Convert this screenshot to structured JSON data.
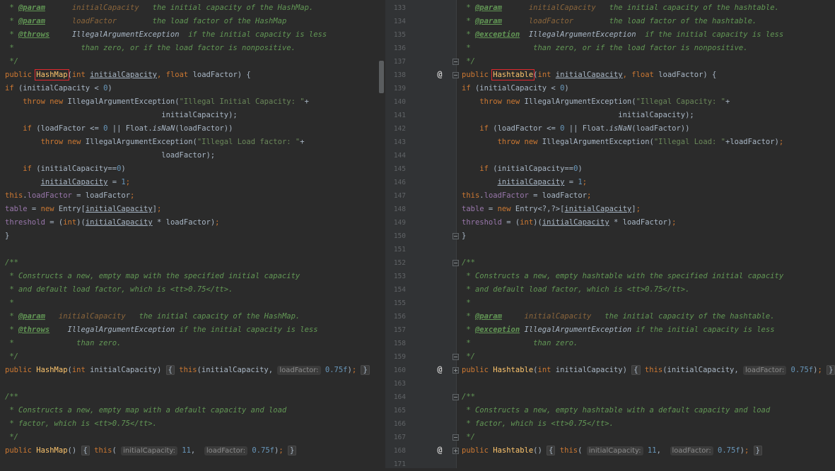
{
  "left_pane": {
    "lines": [
      [
        [
          "cm",
          " * "
        ],
        [
          "tg",
          "@param"
        ],
        [
          "cm",
          "      "
        ],
        [
          "pm",
          "initialCapacity"
        ],
        [
          "cm",
          "   the initial capacity of the HashMap."
        ]
      ],
      [
        [
          "cm",
          " * "
        ],
        [
          "tg",
          "@param"
        ],
        [
          "cm",
          "      "
        ],
        [
          "pm",
          "loadFactor"
        ],
        [
          "cm",
          "        the load factor of the HashMap"
        ]
      ],
      [
        [
          "cm",
          " * "
        ],
        [
          "tg",
          "@throws"
        ],
        [
          "cm",
          "     "
        ],
        [
          "it",
          "IllegalArgumentException"
        ],
        [
          "cm",
          "  if the initial capacity is less"
        ]
      ],
      [
        [
          "cm",
          " *               than zero, or if the load factor is nonpositive."
        ]
      ],
      [
        [
          "cm",
          " */"
        ]
      ],
      [
        [
          "kw",
          "public "
        ],
        [
          "bx",
          "HashMap"
        ],
        [
          "tx",
          "("
        ],
        [
          "kw",
          "int "
        ],
        [
          "ul",
          "initialCapacity"
        ],
        [
          "kw",
          ", float "
        ],
        [
          "tx",
          "loadFactor) {"
        ]
      ],
      [
        [
          "kw",
          "if "
        ],
        [
          "tx",
          "(initialCapacity < "
        ],
        [
          "nm",
          "0"
        ],
        [
          "tx",
          ")"
        ]
      ],
      [
        [
          "tx",
          "    "
        ],
        [
          "kw",
          "throw new "
        ],
        [
          "tx",
          "IllegalArgumentException("
        ],
        [
          "st",
          "\"Illegal Initial Capacity: \""
        ],
        [
          "tx",
          "+"
        ]
      ],
      [
        [
          "tx",
          "                                   initialCapacity);"
        ]
      ],
      [
        [
          "tx",
          "    "
        ],
        [
          "kw",
          "if "
        ],
        [
          "tx",
          "(loadFactor <= "
        ],
        [
          "nm",
          "0 "
        ],
        [
          "tx",
          "|| Float."
        ],
        [
          "it",
          "isNaN"
        ],
        [
          "tx",
          "(loadFactor))"
        ]
      ],
      [
        [
          "tx",
          "        "
        ],
        [
          "kw",
          "throw new "
        ],
        [
          "tx",
          "IllegalArgumentException("
        ],
        [
          "st",
          "\"Illegal Load factor: \""
        ],
        [
          "tx",
          "+"
        ]
      ],
      [
        [
          "tx",
          "                                   loadFactor);"
        ]
      ],
      [
        [
          "tx",
          "    "
        ],
        [
          "kw",
          "if "
        ],
        [
          "tx",
          "(initialCapacity=="
        ],
        [
          "nm",
          "0"
        ],
        [
          "tx",
          ")"
        ]
      ],
      [
        [
          "tx",
          "        "
        ],
        [
          "ul",
          "initialCapacity"
        ],
        [
          "tx",
          " = "
        ],
        [
          "nm",
          "1"
        ],
        [
          "kw",
          ";"
        ]
      ],
      [
        [
          "kw",
          "this"
        ],
        [
          "tx",
          "."
        ],
        [
          "fd",
          "loadFactor"
        ],
        [
          "tx",
          " = loadFactor"
        ],
        [
          "kw",
          ";"
        ]
      ],
      [
        [
          "fd",
          "table"
        ],
        [
          "tx",
          " = "
        ],
        [
          "kw",
          "new "
        ],
        [
          "tx",
          "Entry["
        ],
        [
          "ul",
          "initialCapacity"
        ],
        [
          "tx",
          "]"
        ],
        [
          "kw",
          ";"
        ]
      ],
      [
        [
          "fd",
          "threshold"
        ],
        [
          "tx",
          " = ("
        ],
        [
          "kw",
          "int"
        ],
        [
          "tx",
          ")("
        ],
        [
          "ul",
          "initialCapacity"
        ],
        [
          "tx",
          " * loadFactor)"
        ],
        [
          "kw",
          ";"
        ]
      ],
      [
        [
          "tx",
          "}"
        ]
      ],
      [],
      [
        [
          "cm",
          "/**"
        ]
      ],
      [
        [
          "cm",
          " * Constructs a new, empty map with the specified initial capacity"
        ]
      ],
      [
        [
          "cm",
          " * and default load factor, which is <tt>0.75</tt>."
        ]
      ],
      [
        [
          "cm",
          " *"
        ]
      ],
      [
        [
          "cm",
          " * "
        ],
        [
          "tg",
          "@param"
        ],
        [
          "cm",
          "   "
        ],
        [
          "pm",
          "initialCapacity"
        ],
        [
          "cm",
          "   the initial capacity of the HashMap."
        ]
      ],
      [
        [
          "cm",
          " * "
        ],
        [
          "tg",
          "@throws"
        ],
        [
          "cm",
          "    "
        ],
        [
          "it",
          "IllegalArgumentException"
        ],
        [
          "cm",
          " if the initial capacity is less"
        ]
      ],
      [
        [
          "cm",
          " *              than zero."
        ]
      ],
      [
        [
          "cm",
          " */"
        ]
      ],
      [
        [
          "kw",
          "public "
        ],
        [
          "fn",
          "HashMap"
        ],
        [
          "tx",
          "("
        ],
        [
          "kw",
          "int "
        ],
        [
          "tx",
          "initialCapacity) "
        ],
        [
          "fb",
          "{"
        ],
        [
          "tx",
          " "
        ],
        [
          "kw",
          "this"
        ],
        [
          "tx",
          "(initialCapacity, "
        ],
        [
          "hn",
          "loadFactor:"
        ],
        [
          "nm",
          " 0.75f"
        ],
        [
          "tx",
          ")"
        ],
        [
          "kw",
          "; "
        ],
        [
          "fb",
          "}"
        ]
      ],
      [],
      [
        [
          "cm",
          "/**"
        ]
      ],
      [
        [
          "cm",
          " * Constructs a new, empty map with a default capacity and load"
        ]
      ],
      [
        [
          "cm",
          " * factor, which is <tt>0.75</tt>."
        ]
      ],
      [
        [
          "cm",
          " */"
        ]
      ],
      [
        [
          "kw",
          "public "
        ],
        [
          "fn",
          "HashMap"
        ],
        [
          "tx",
          "() "
        ],
        [
          "fb",
          "{"
        ],
        [
          "tx",
          " "
        ],
        [
          "kw",
          "this"
        ],
        [
          "tx",
          "( "
        ],
        [
          "hn",
          "initialCapacity:"
        ],
        [
          "nm",
          " 11"
        ],
        [
          "tx",
          ",  "
        ],
        [
          "hn",
          "loadFactor:"
        ],
        [
          "nm",
          " 0.75f"
        ],
        [
          "tx",
          ")"
        ],
        [
          "kw",
          "; "
        ],
        [
          "fb",
          "}"
        ]
      ]
    ]
  },
  "right_pane": {
    "lines": [
      [
        [
          "cm",
          " * "
        ],
        [
          "tg",
          "@param"
        ],
        [
          "cm",
          "      "
        ],
        [
          "pm",
          "initialCapacity"
        ],
        [
          "cm",
          "   the initial capacity of the hashtable."
        ]
      ],
      [
        [
          "cm",
          " * "
        ],
        [
          "tg",
          "@param"
        ],
        [
          "cm",
          "      "
        ],
        [
          "pm",
          "loadFactor"
        ],
        [
          "cm",
          "        the load factor of the hashtable."
        ]
      ],
      [
        [
          "cm",
          " * "
        ],
        [
          "tg",
          "@exception"
        ],
        [
          "cm",
          "  "
        ],
        [
          "it",
          "IllegalArgumentException"
        ],
        [
          "cm",
          "  if the initial capacity is less"
        ]
      ],
      [
        [
          "cm",
          " *              than zero, or if the load factor is nonpositive."
        ]
      ],
      [
        [
          "cm",
          " */"
        ]
      ],
      [
        [
          "kw",
          "public "
        ],
        [
          "bx",
          "Hashtable"
        ],
        [
          "tx",
          "("
        ],
        [
          "kw",
          "int "
        ],
        [
          "ul",
          "initialCapacity"
        ],
        [
          "kw",
          ", float "
        ],
        [
          "tx",
          "loadFactor) {"
        ]
      ],
      [
        [
          "kw",
          "if "
        ],
        [
          "tx",
          "(initialCapacity < "
        ],
        [
          "nm",
          "0"
        ],
        [
          "tx",
          ")"
        ]
      ],
      [
        [
          "tx",
          "    "
        ],
        [
          "kw",
          "throw new "
        ],
        [
          "tx",
          "IllegalArgumentException("
        ],
        [
          "st",
          "\"Illegal Capacity: \""
        ],
        [
          "tx",
          "+"
        ]
      ],
      [
        [
          "tx",
          "                                   initialCapacity);"
        ]
      ],
      [
        [
          "tx",
          "    "
        ],
        [
          "kw",
          "if "
        ],
        [
          "tx",
          "(loadFactor <= "
        ],
        [
          "nm",
          "0 "
        ],
        [
          "tx",
          "|| Float."
        ],
        [
          "it",
          "isNaN"
        ],
        [
          "tx",
          "(loadFactor))"
        ]
      ],
      [
        [
          "tx",
          "        "
        ],
        [
          "kw",
          "throw new "
        ],
        [
          "tx",
          "IllegalArgumentException("
        ],
        [
          "st",
          "\"Illegal Load: \""
        ],
        [
          "tx",
          "+loadFactor)"
        ],
        [
          "kw",
          ";"
        ]
      ],
      [],
      [
        [
          "tx",
          "    "
        ],
        [
          "kw",
          "if "
        ],
        [
          "tx",
          "(initialCapacity=="
        ],
        [
          "nm",
          "0"
        ],
        [
          "tx",
          ")"
        ]
      ],
      [
        [
          "tx",
          "        "
        ],
        [
          "ul",
          "initialCapacity"
        ],
        [
          "tx",
          " = "
        ],
        [
          "nm",
          "1"
        ],
        [
          "kw",
          ";"
        ]
      ],
      [
        [
          "kw",
          "this"
        ],
        [
          "tx",
          "."
        ],
        [
          "fd",
          "loadFactor"
        ],
        [
          "tx",
          " = loadFactor"
        ],
        [
          "kw",
          ";"
        ]
      ],
      [
        [
          "fd",
          "table"
        ],
        [
          "tx",
          " = "
        ],
        [
          "kw",
          "new "
        ],
        [
          "tx",
          "Entry<?,?>["
        ],
        [
          "ul",
          "initialCapacity"
        ],
        [
          "tx",
          "]"
        ],
        [
          "kw",
          ";"
        ]
      ],
      [
        [
          "fd",
          "threshold"
        ],
        [
          "tx",
          " = ("
        ],
        [
          "kw",
          "int"
        ],
        [
          "tx",
          ")("
        ],
        [
          "ul",
          "initialCapacity"
        ],
        [
          "tx",
          " * loadFactor)"
        ],
        [
          "kw",
          ";"
        ]
      ],
      [
        [
          "tx",
          "}"
        ]
      ],
      [],
      [
        [
          "cm",
          "/**"
        ]
      ],
      [
        [
          "cm",
          " * Constructs a new, empty hashtable with the specified initial capacity"
        ]
      ],
      [
        [
          "cm",
          " * and default load factor, which is <tt>0.75</tt>."
        ]
      ],
      [
        [
          "cm",
          " *"
        ]
      ],
      [
        [
          "cm",
          " * "
        ],
        [
          "tg",
          "@param"
        ],
        [
          "cm",
          "     "
        ],
        [
          "pm",
          "initialCapacity"
        ],
        [
          "cm",
          "   the initial capacity of the hashtable."
        ]
      ],
      [
        [
          "cm",
          " * "
        ],
        [
          "tg",
          "@exception"
        ],
        [
          "cm",
          " "
        ],
        [
          "it",
          "IllegalArgumentException"
        ],
        [
          "cm",
          " if the initial capacity is less"
        ]
      ],
      [
        [
          "cm",
          " *              than zero."
        ]
      ],
      [
        [
          "cm",
          " */"
        ]
      ],
      [
        [
          "kw",
          "public "
        ],
        [
          "fn",
          "Hashtable"
        ],
        [
          "tx",
          "("
        ],
        [
          "kw",
          "int "
        ],
        [
          "tx",
          "initialCapacity) "
        ],
        [
          "fb",
          "{"
        ],
        [
          "tx",
          " "
        ],
        [
          "kw",
          "this"
        ],
        [
          "tx",
          "(initialCapacity, "
        ],
        [
          "hn",
          "loadFactor:"
        ],
        [
          "nm",
          " 0.75f"
        ],
        [
          "tx",
          ")"
        ],
        [
          "kw",
          "; "
        ],
        [
          "fb",
          "}"
        ]
      ],
      [],
      [
        [
          "cm",
          "/**"
        ]
      ],
      [
        [
          "cm",
          " * Constructs a new, empty hashtable with a default capacity and load"
        ]
      ],
      [
        [
          "cm",
          " * factor, which is <tt>0.75</tt>."
        ]
      ],
      [
        [
          "cm",
          " */"
        ]
      ],
      [
        [
          "kw",
          "public "
        ],
        [
          "fn",
          "Hashtable"
        ],
        [
          "tx",
          "() "
        ],
        [
          "fb",
          "{"
        ],
        [
          "tx",
          " "
        ],
        [
          "kw",
          "this"
        ],
        [
          "tx",
          "( "
        ],
        [
          "hn",
          "initialCapacity:"
        ],
        [
          "nm",
          " 11"
        ],
        [
          "tx",
          ",  "
        ],
        [
          "hn",
          "loadFactor:"
        ],
        [
          "nm",
          " 0.75f"
        ],
        [
          "tx",
          ")"
        ],
        [
          "kw",
          "; "
        ],
        [
          "fb",
          "}"
        ]
      ]
    ]
  },
  "gutter": {
    "line_numbers": [
      "133",
      "134",
      "135",
      "136",
      "137",
      "138",
      "139",
      "140",
      "141",
      "142",
      "143",
      "144",
      "145",
      "146",
      "147",
      "148",
      "149",
      "150",
      "151",
      "152",
      "153",
      "154",
      "155",
      "156",
      "157",
      "158",
      "159",
      "160",
      "163",
      "164",
      "165",
      "166",
      "167",
      "168",
      "171"
    ],
    "override_marker": "@",
    "markers": [
      {
        "row": 5,
        "override": true,
        "fold": "minus"
      },
      {
        "row": 4,
        "fold": "minus"
      },
      {
        "row": 17,
        "fold": "minus"
      },
      {
        "row": 19,
        "fold": "minus"
      },
      {
        "row": 26,
        "fold": "minus"
      },
      {
        "row": 27,
        "override": true,
        "fold": "plus"
      },
      {
        "row": 29,
        "fold": "minus"
      },
      {
        "row": 32,
        "fold": "minus"
      },
      {
        "row": 33,
        "override": true,
        "fold": "plus"
      }
    ]
  },
  "colors": {
    "background": "#2b2b2b",
    "gutter": "#313335",
    "keyword": "#cc7832",
    "comment": "#629755",
    "method": "#ffc66d",
    "field": "#9876aa",
    "number": "#6897bb",
    "string": "#6a8759",
    "highlight_box": "#e0282e"
  }
}
